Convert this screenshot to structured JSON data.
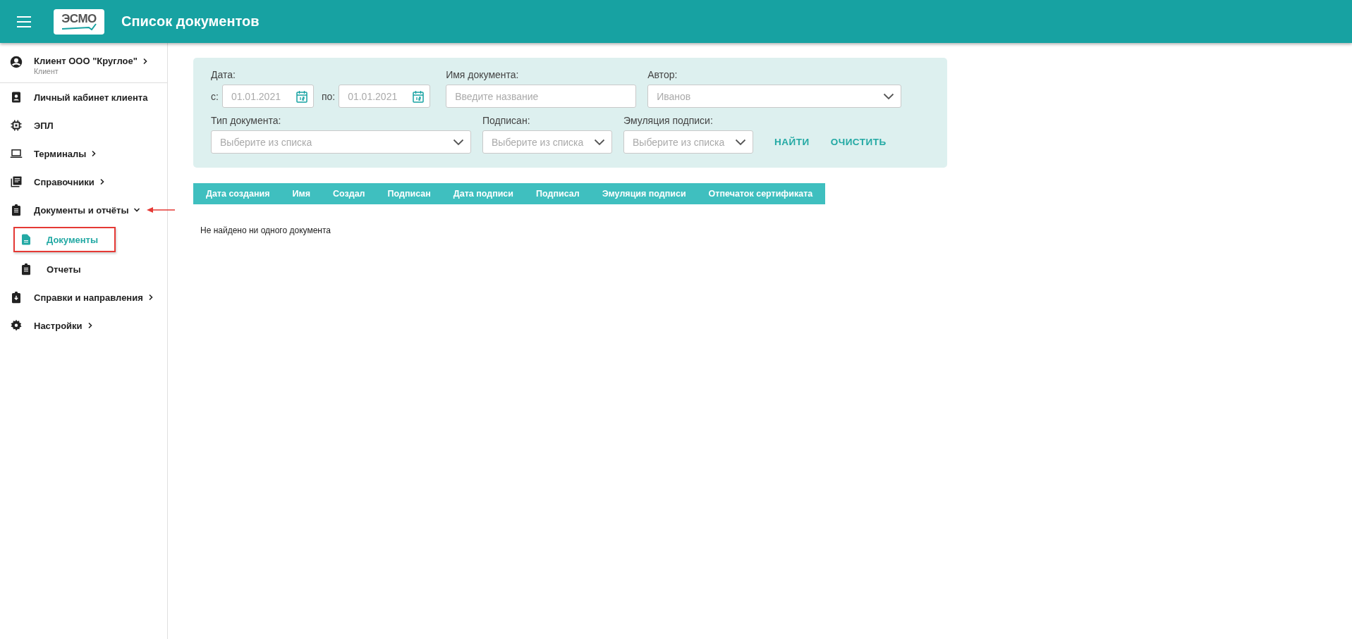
{
  "header": {
    "logo": "ЭСМО",
    "title": "Список документов"
  },
  "sidebar": {
    "user": {
      "name": "Клиент ООО \"Круглое\"",
      "role": "Клиент"
    },
    "items": [
      {
        "label": "Личный кабинет клиента",
        "selected": false
      },
      {
        "label": "ЭПЛ",
        "selected": false
      },
      {
        "label": "Терминалы",
        "expanded": false,
        "selected": false
      },
      {
        "label": "Справочники",
        "expanded": false,
        "selected": false
      },
      {
        "label": "Документы и отчёты",
        "expanded": true,
        "selected": false,
        "children": [
          {
            "label": "Документы",
            "selected": true
          },
          {
            "label": "Отчеты",
            "selected": false
          }
        ]
      },
      {
        "label": "Справки и направления",
        "expanded": false,
        "selected": false
      },
      {
        "label": "Настройки",
        "expanded": false,
        "selected": false
      }
    ]
  },
  "filters": {
    "rows": [
      [
        {
          "kind": "daterange",
          "label": "Дата:",
          "from_label": "с:",
          "from_value": "01.01.2021",
          "to_label": "по:",
          "to_value": "01.01.2021"
        },
        {
          "kind": "text",
          "label": "Имя документа:",
          "placeholder": "Введите название"
        },
        {
          "kind": "select",
          "label": "Автор:",
          "placeholder": "Иванов"
        }
      ],
      [
        {
          "kind": "select",
          "label": "Тип документа:",
          "placeholder": "Выберите из списка"
        },
        {
          "kind": "select",
          "label": "Подписан:",
          "placeholder": "Выберите из списка"
        },
        {
          "kind": "select",
          "label": "Эмуляция подписи:",
          "placeholder": "Выберите из списка"
        }
      ]
    ],
    "buttons": [
      "НАЙТИ",
      "ОЧИСТИТЬ"
    ]
  },
  "table": {
    "columns": [
      "Дата создания",
      "Имя",
      "Создал",
      "Подписан",
      "Дата подписи",
      "Подписал",
      "Эмуляция подписи",
      "Отпечаток сертификата"
    ],
    "empty_message": "Не найдено ни одного документа"
  }
}
